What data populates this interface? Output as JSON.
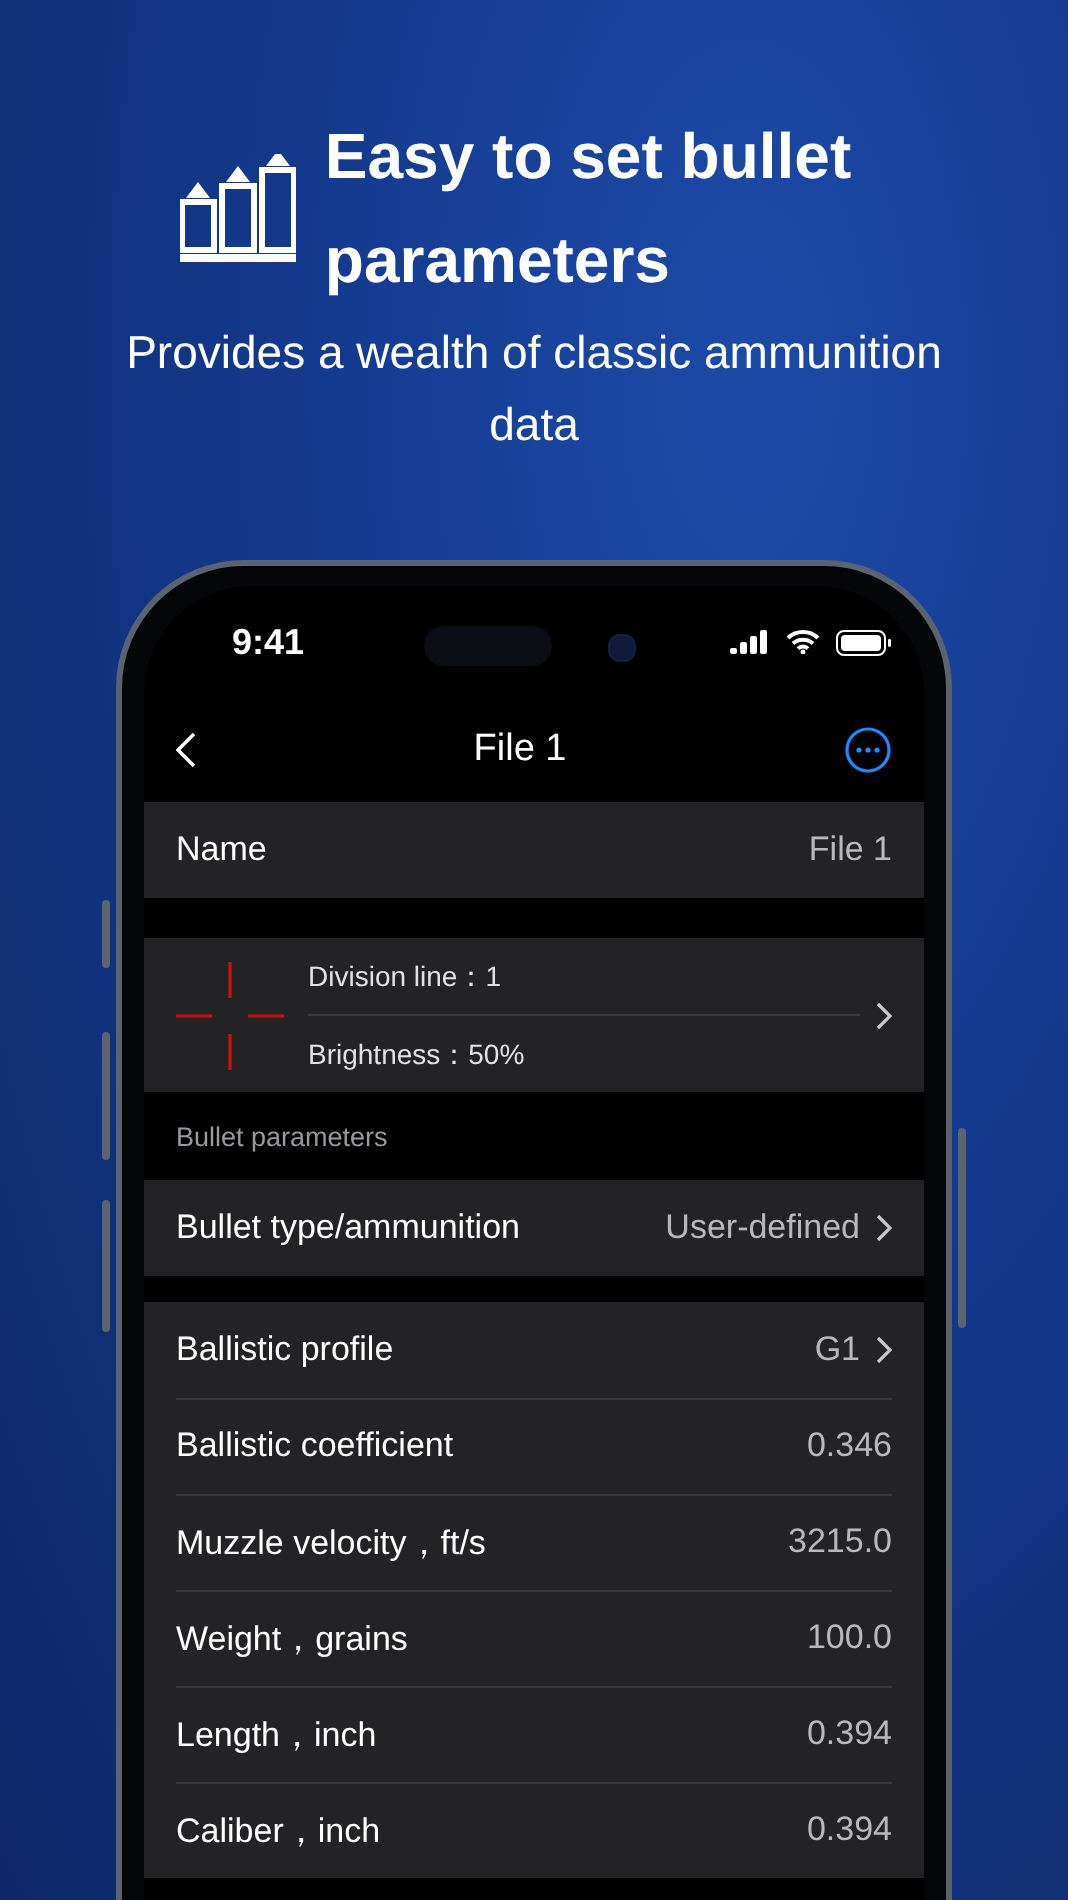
{
  "header": {
    "title_lines": [
      "Easy to set bullet",
      "parameters"
    ],
    "subtitle": "Provides a wealth of classic ammunition data"
  },
  "status_bar": {
    "time": "9:41"
  },
  "nav": {
    "title": "File 1"
  },
  "name_row": {
    "label": "Name",
    "value": "File 1"
  },
  "reticle_row": {
    "lines": [
      "Division line：1",
      "Brightness：50%"
    ]
  },
  "section_label": "Bullet parameters",
  "ammo_row": {
    "label": "Bullet type/ammunition",
    "value": "User-defined",
    "kind": "nav"
  },
  "params": [
    {
      "label": "Ballistic profile",
      "value": "G1",
      "kind": "nav"
    },
    {
      "label": "Ballistic coefficient",
      "value": "0.346",
      "kind": "value"
    },
    {
      "label": "Muzzle velocity，ft/s",
      "value": "3215.0",
      "kind": "value"
    },
    {
      "label": "Weight，grains",
      "value": "100.0",
      "kind": "value"
    },
    {
      "label": "Length，inch",
      "value": "0.394",
      "kind": "value"
    },
    {
      "label": "Caliber，inch",
      "value": "0.394",
      "kind": "value"
    }
  ]
}
